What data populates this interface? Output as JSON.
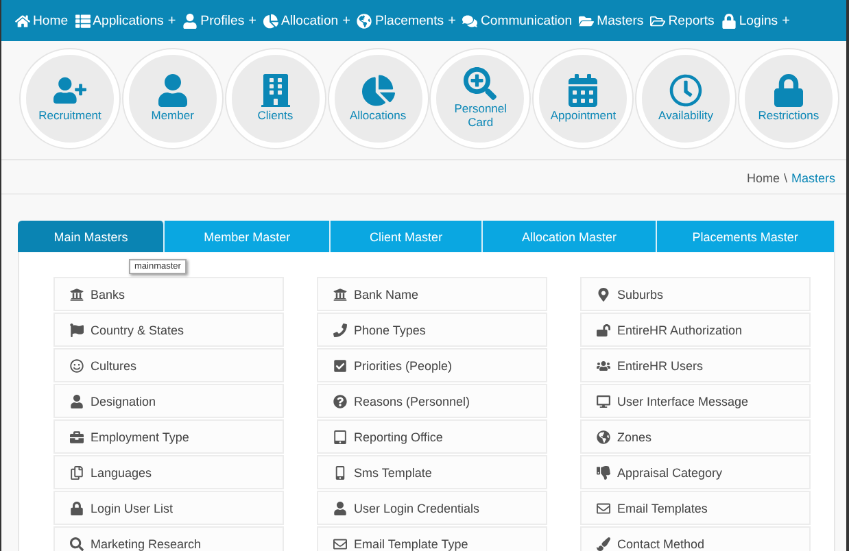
{
  "nav": [
    {
      "label": "Home"
    },
    {
      "label": "Applications",
      "plus": "+"
    },
    {
      "label": "Profiles",
      "plus": "+"
    },
    {
      "label": "Allocation",
      "plus": "+"
    },
    {
      "label": "Placements",
      "plus": "+"
    },
    {
      "label": "Communication"
    },
    {
      "label": "Masters"
    },
    {
      "label": "Reports"
    },
    {
      "label": "Logins",
      "plus": "+"
    }
  ],
  "shortcuts": [
    {
      "label": "Recruitment"
    },
    {
      "label": "Member"
    },
    {
      "label": "Clients"
    },
    {
      "label": "Allocations"
    },
    {
      "label": "Personnel Card"
    },
    {
      "label": "Appointment"
    },
    {
      "label": "Availability"
    },
    {
      "label": "Restrictions"
    }
  ],
  "breadcrumb": {
    "home": "Home",
    "separator": "\\",
    "current": "Masters"
  },
  "tabs": [
    {
      "label": "Main Masters",
      "selected": true
    },
    {
      "label": "Member Master",
      "selected": false
    },
    {
      "label": "Client Master",
      "selected": false
    },
    {
      "label": "Allocation Master",
      "selected": false
    },
    {
      "label": "Placements Master",
      "selected": false
    }
  ],
  "tooltip": "mainmaster",
  "columns": [
    [
      "Banks",
      "Country & States",
      "Cultures",
      "Designation",
      "Employment Type",
      "Languages",
      "Login User List",
      "Marketing Research"
    ],
    [
      "Bank Name",
      "Phone Types",
      "Priorities (People)",
      "Reasons (Personnel)",
      "Reporting Office",
      "Sms Template",
      "User Login Credentials",
      "Email Template Type"
    ],
    [
      "Suburbs",
      "EntireHR Authorization",
      "EntireHR Users",
      "User Interface Message",
      "Zones",
      "Appraisal Category",
      "Email Templates",
      "Contact Method"
    ]
  ]
}
